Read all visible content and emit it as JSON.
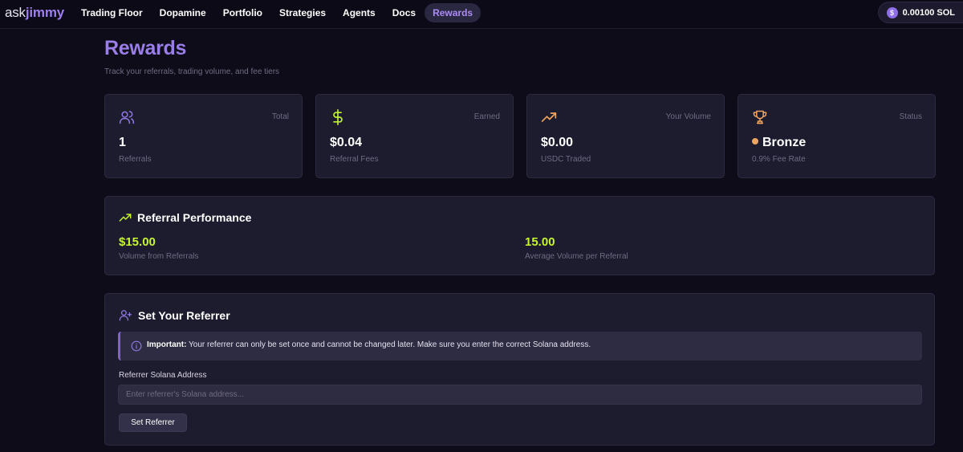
{
  "app": {
    "logo_part1": "ask",
    "logo_part2": "jimmy"
  },
  "nav": {
    "items": [
      {
        "label": "Trading Floor"
      },
      {
        "label": "Dopamine"
      },
      {
        "label": "Portfolio"
      },
      {
        "label": "Strategies"
      },
      {
        "label": "Agents"
      },
      {
        "label": "Docs"
      },
      {
        "label": "Rewards",
        "active": true
      }
    ]
  },
  "wallet": {
    "coin_symbol": "$",
    "balance": "0.00100 SOL"
  },
  "header": {
    "title": "Rewards",
    "subtitle": "Track your referrals, trading volume, and fee tiers"
  },
  "stats": [
    {
      "icon": "users-icon",
      "tag": "Total",
      "value": "1",
      "caption": "Referrals",
      "icon_color": "#8f78e0"
    },
    {
      "icon": "dollar-icon",
      "tag": "Earned",
      "value": "$0.04",
      "caption": "Referral Fees",
      "icon_color": "#bff03a"
    },
    {
      "icon": "trending-up-icon",
      "tag": "Your Volume",
      "value": "$0.00",
      "caption": "USDC Traded",
      "icon_color": "#f0a45e"
    },
    {
      "icon": "trophy-icon",
      "tag": "Status",
      "value": "Bronze",
      "caption": "0.9% Fee Rate",
      "icon_color": "#f0a45e"
    }
  ],
  "performance": {
    "title": "Referral Performance",
    "volume_value": "$15.00",
    "volume_caption": "Volume from Referrals",
    "avg_value": "15.00",
    "avg_caption": "Average Volume per Referral"
  },
  "referrer": {
    "title": "Set Your Referrer",
    "notice_bold": "Important:",
    "notice_text": " Your referrer can only be set once and cannot be changed later. Make sure you enter the correct Solana address.",
    "field_label": "Referrer Solana Address",
    "field_value": "",
    "field_placeholder": "Enter referrer's Solana address...",
    "button_label": "Set Referrer"
  },
  "colors": {
    "accent": "#9a7ee8",
    "green": "#c6f435",
    "orange": "#f0a45e",
    "background": "#0e0c18",
    "card": "#1d1b2e"
  }
}
